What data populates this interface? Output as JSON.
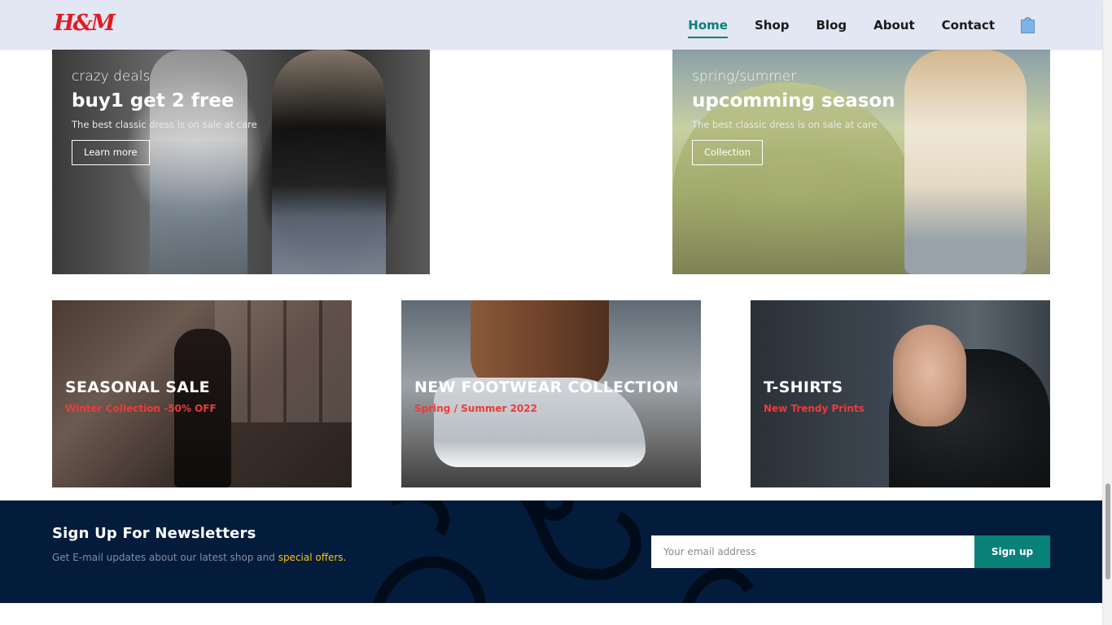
{
  "header": {
    "logo_text": "H&M",
    "nav": [
      "Home",
      "Shop",
      "Blog",
      "About",
      "Contact"
    ],
    "active_nav": "Home",
    "cart_icon": "shopping-bag-icon"
  },
  "banners": [
    {
      "small": "crazy deals",
      "big": "buy1 get 2 free",
      "desc": "The best classic dress is on sale at care",
      "button": "Learn more"
    },
    {
      "small": "spring/summer",
      "big": "upcomming season",
      "desc": "The best classic dress is on sale at care",
      "button": "Collection"
    }
  ],
  "collections": [
    {
      "title": "SEASONAL SALE",
      "subtitle": "Winter Collection -50% OFF"
    },
    {
      "title": "NEW FOOTWEAR COLLECTION",
      "subtitle": "Spring / Summer 2022"
    },
    {
      "title": "T-SHIRTS",
      "subtitle": "New Trendy Prints"
    }
  ],
  "newsletter": {
    "title": "Sign Up For Newsletters",
    "desc_prefix": "Get E-mail updates about our latest shop and ",
    "desc_highlight": "special offers.",
    "placeholder": "Your email address",
    "button": "Sign up"
  },
  "colors": {
    "accent": "#088178",
    "header_bg": "#e3e6f3",
    "newsletter_bg": "#041c3c",
    "sale_red": "#ec3b3b",
    "highlight_yellow": "#f5c518",
    "logo_red": "#e11b22"
  }
}
